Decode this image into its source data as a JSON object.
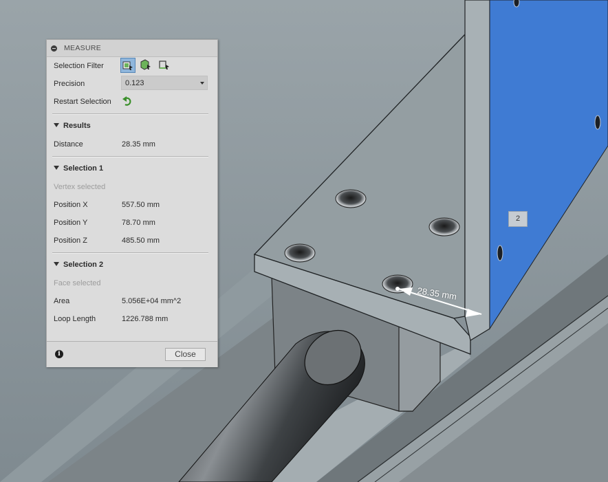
{
  "panel": {
    "title": "MEASURE",
    "selection_filter_label": "Selection Filter",
    "precision_label": "Precision",
    "precision_value": "0.123",
    "restart_label": "Restart Selection",
    "close_label": "Close",
    "info_glyph": "i"
  },
  "results": {
    "title": "Results",
    "distance_label": "Distance",
    "distance_value": "28.35 mm"
  },
  "selection1": {
    "title": "Selection 1",
    "status": "Vertex selected",
    "x_label": "Position X",
    "x_value": "557.50 mm",
    "y_label": "Position Y",
    "y_value": "78.70 mm",
    "z_label": "Position Z",
    "z_value": "485.50 mm"
  },
  "selection2": {
    "title": "Selection 2",
    "status": "Face selected",
    "area_label": "Area",
    "area_value": "5.056E+04 mm^2",
    "loop_label": "Loop Length",
    "loop_value": "1226.788 mm"
  },
  "viewport": {
    "dimension_label": "28.35 mm",
    "badge": "2"
  },
  "colors": {
    "selected_face": "#3f7bd3",
    "part_gray": "#8f9699",
    "panel_bg": "#dcdcdc",
    "active_filter": "#8fb6dc"
  },
  "icons": [
    "body-filter-icon",
    "face-filter-icon",
    "edge-filter-icon",
    "restart-icon",
    "info-icon",
    "collapse-icon"
  ]
}
